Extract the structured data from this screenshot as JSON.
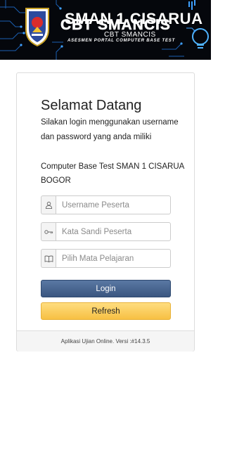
{
  "header": {
    "school_name": "SMAN 1 CISARUA",
    "overlay_text": "CBT SMANCIS",
    "subtitle": "CBT SMANCIS",
    "tagline": "ASESMEN PORTAL COMPUTER BASE TEST"
  },
  "login": {
    "welcome": "Selamat Datang",
    "intro": "Silakan login menggunakan username dan password yang anda miliki",
    "school": "Computer Base Test SMAN 1 CISARUA BOGOR",
    "username_placeholder": "Username Peserta",
    "password_placeholder": "Kata Sandi Peserta",
    "subject_placeholder": "Pilih Mata Pelajaran",
    "login_label": "Login",
    "refresh_label": "Refresh",
    "footer": "Aplikasi Ujian Online. Versi :#14.3.5"
  },
  "icons": {
    "username": "user-icon",
    "password": "key-icon",
    "subject": "book-icon"
  },
  "colors": {
    "login_button": "#3f5b85",
    "refresh_button": "#fcd062",
    "banner_bg": "#05070c",
    "circuit": "#1e6fd0"
  }
}
